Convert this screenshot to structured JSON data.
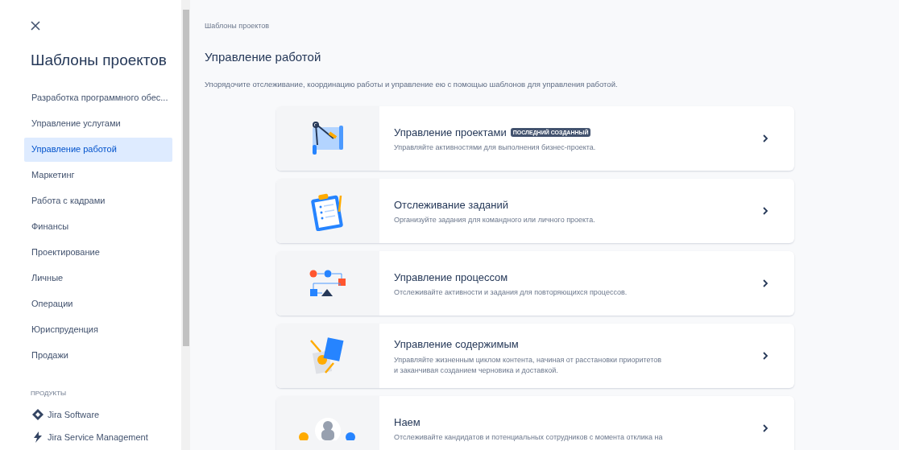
{
  "sidebar": {
    "title": "Шаблоны проектов",
    "items": [
      {
        "label": "Разработка программного обес...",
        "selected": false
      },
      {
        "label": "Управление услугами",
        "selected": false
      },
      {
        "label": "Управление работой",
        "selected": true
      },
      {
        "label": "Маркетинг",
        "selected": false
      },
      {
        "label": "Работа с кадрами",
        "selected": false
      },
      {
        "label": "Финансы",
        "selected": false
      },
      {
        "label": "Проектирование",
        "selected": false
      },
      {
        "label": "Личные",
        "selected": false
      },
      {
        "label": "Операции",
        "selected": false
      },
      {
        "label": "Юриспруденция",
        "selected": false
      },
      {
        "label": "Продажи",
        "selected": false
      }
    ],
    "products_heading": "ПРОДУКТЫ",
    "products": [
      {
        "label": "Jira Software"
      },
      {
        "label": "Jira Service Management"
      }
    ]
  },
  "breadcrumb": "Шаблоны проектов",
  "heading": "Управление работой",
  "description": "Упорядочите отслеживание, координацию работы и управление ею с помощью шаблонов для управления работой.",
  "templates": [
    {
      "title": "Управление проектами",
      "badge": "ПОСЛЕДНИЙ СОЗДАННЫЙ",
      "description": "Управляйте активностями для выполнения бизнес-проекта."
    },
    {
      "title": "Отслеживание заданий",
      "description": "Организуйте задания для командного или личного проекта."
    },
    {
      "title": "Управление процессом",
      "description": "Отслеживайте активности и задания для повторяющихся процессов."
    },
    {
      "title": "Управление содержимым",
      "description": "Управляйте жизненным циклом контента, начиная от расстановки приоритетов и заканчивая созданием черновика и доставкой."
    },
    {
      "title": "Наем",
      "description": "Отслеживайте кандидатов и потенциальных сотрудников с момента отклика на"
    }
  ]
}
